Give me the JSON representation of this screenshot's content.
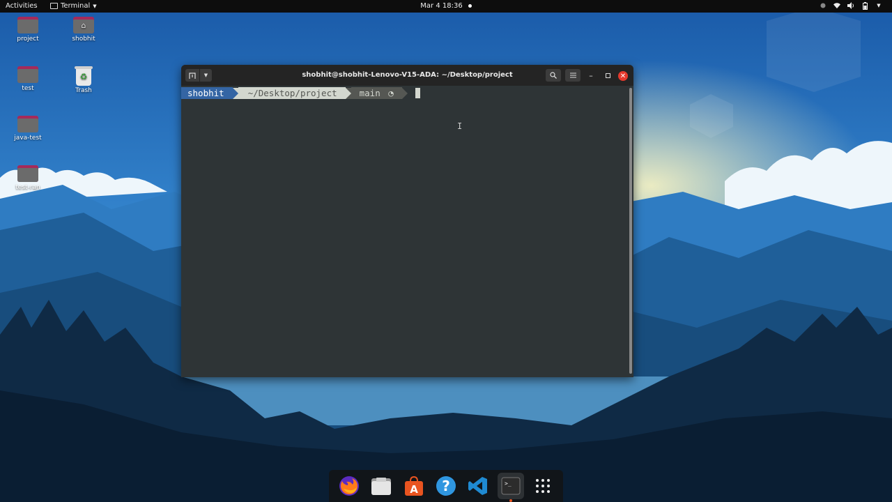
{
  "topbar": {
    "activities_label": "Activities",
    "app_menu_label": "Terminal",
    "clock_label": "Mar 4  18:36"
  },
  "desktop": {
    "icons": [
      {
        "label": "project",
        "kind": "folder"
      },
      {
        "label": "shobhit",
        "kind": "home-folder"
      },
      {
        "label": "test",
        "kind": "folder"
      },
      {
        "label": "Trash",
        "kind": "trash"
      },
      {
        "label": "java-test",
        "kind": "folder"
      },
      {
        "label": "test-ran",
        "kind": "folder"
      }
    ]
  },
  "terminal": {
    "title": "shobhit@shobhit-Lenovo-V15-ADA: ~/Desktop/project",
    "prompt": {
      "user": "shobhit",
      "path": "~/Desktop/project",
      "branch": "main"
    }
  },
  "dock": {
    "apps": [
      "firefox-icon",
      "files-icon",
      "app-store-icon",
      "help-icon",
      "vscode-icon",
      "terminal-icon",
      "show-apps-icon"
    ],
    "active_app": "terminal-icon"
  },
  "colors": {
    "accent": "#e95420",
    "prompt_user_bg": "#3465a4",
    "prompt_path_bg": "#d3d7cf",
    "prompt_git_bg": "#555753",
    "terminal_bg": "#2e3436",
    "close_button": "#e5392d"
  }
}
